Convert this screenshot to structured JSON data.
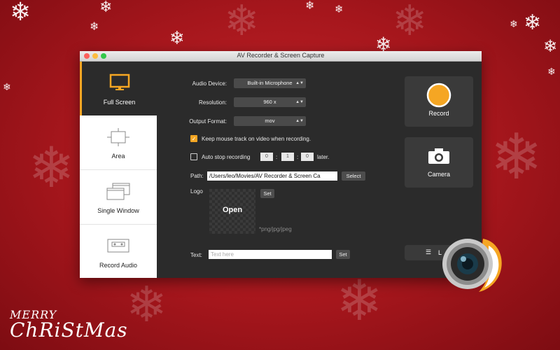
{
  "window": {
    "title": "AV Recorder & Screen Capture"
  },
  "sidebar": {
    "items": [
      {
        "label": "Full Screen",
        "icon": "monitor-icon"
      },
      {
        "label": "Area",
        "icon": "area-select-icon"
      },
      {
        "label": "Single Window",
        "icon": "windows-icon"
      },
      {
        "label": "Record Audio",
        "icon": "cassette-icon"
      }
    ],
    "active": "Full Screen"
  },
  "settings": {
    "audio_device": {
      "label": "Audio Device:",
      "value": "Built-in Microphone"
    },
    "resolution": {
      "label": "Resolution:",
      "value": "960 x"
    },
    "output_format": {
      "label": "Output Format:",
      "value": "mov"
    },
    "keep_mouse": {
      "label": "Keep mouse track on video when recording.",
      "checked": true
    },
    "auto_stop": {
      "label": "Auto stop recording",
      "checked": false,
      "h": "0",
      "m": "1",
      "s": "0",
      "sep": ":",
      "suffix": "later."
    },
    "path": {
      "label": "Path:",
      "value": "/Users/leo/Movies/AV Recorder & Screen Ca",
      "button": "Select"
    },
    "logo": {
      "label": "Logo",
      "button": "Set",
      "open_label": "Open",
      "hint": "*png/jpg/jpeg"
    },
    "text": {
      "label": "Text:",
      "placeholder": "Text here",
      "button": "Set"
    }
  },
  "actions": {
    "record": {
      "label": "Record"
    },
    "camera": {
      "label": "Camera"
    },
    "list_partial": "L"
  },
  "background": {
    "greeting_line1": "MERRY",
    "greeting_line2": "ChRiStMas"
  },
  "colors": {
    "accent": "#f5a623",
    "background": "#b01c22",
    "panel": "#2b2b2b"
  }
}
